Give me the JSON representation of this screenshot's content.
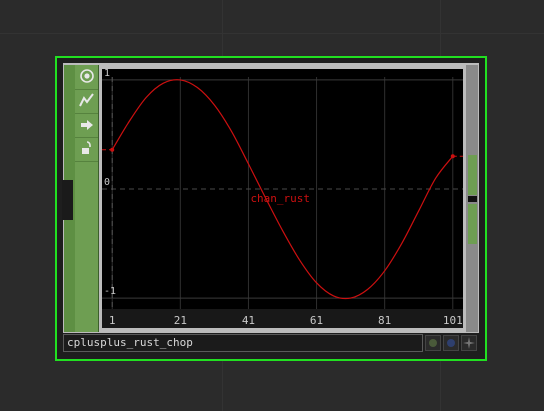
{
  "node": {
    "name": "cplusplus_rust_chop",
    "border_color": "#21e021",
    "rail_color": "#6e9e52"
  },
  "toolbar": {
    "buttons": [
      {
        "icon": "viewer-active-icon"
      },
      {
        "icon": "graph-icon"
      },
      {
        "icon": "arrow-right-icon"
      },
      {
        "icon": "lock-icon"
      }
    ]
  },
  "flags": [
    {
      "icon": "bypass-flag-icon",
      "color": "#4a5a3a"
    },
    {
      "icon": "display-flag-icon",
      "color": "#2e3f6e"
    },
    {
      "icon": "viewer-flag-icon",
      "color": "#777777"
    }
  ],
  "chart_data": {
    "type": "line",
    "series": [
      {
        "name": "chan_rust",
        "color": "#cc1010",
        "x": [
          1,
          6,
          11,
          16,
          21,
          26,
          31,
          36,
          41,
          46,
          51,
          56,
          61,
          66,
          71,
          76,
          81,
          86,
          91,
          96,
          101
        ],
        "y": [
          0.36,
          0.62,
          0.84,
          0.97,
          1.0,
          0.93,
          0.77,
          0.53,
          0.23,
          -0.08,
          -0.38,
          -0.65,
          -0.86,
          -0.98,
          -1.0,
          -0.92,
          -0.75,
          -0.5,
          -0.2,
          0.1,
          0.3
        ]
      }
    ],
    "x_ticks": [
      "1",
      "21",
      "41",
      "61",
      "81",
      "101"
    ],
    "y_ticks": [
      "1",
      "0",
      "-1"
    ],
    "xlim": [
      -2,
      104
    ],
    "ylim": [
      -1.1,
      1.1
    ],
    "grid": true
  }
}
